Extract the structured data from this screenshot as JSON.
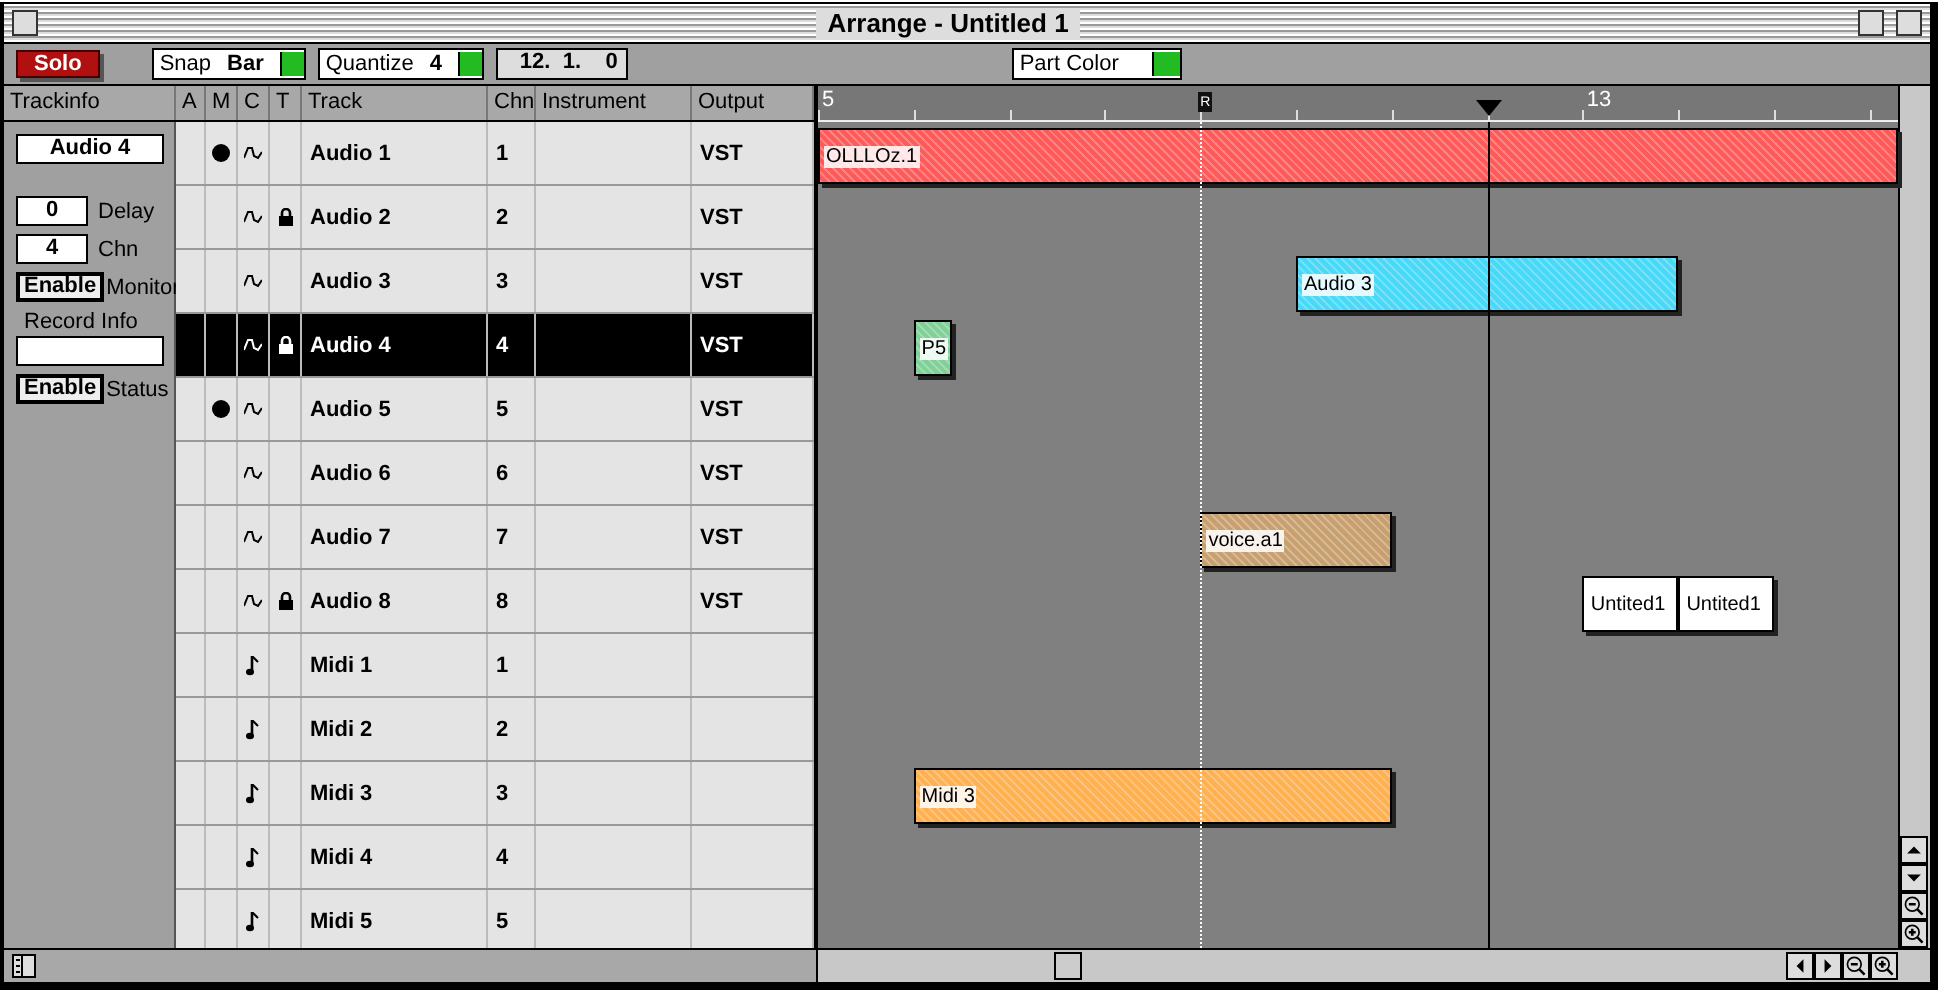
{
  "window": {
    "title": "Arrange - Untitled 1"
  },
  "toolbar": {
    "solo": "Solo",
    "snap": {
      "label": "Snap",
      "value": "Bar"
    },
    "quantize": {
      "label": "Quantize",
      "value": "4"
    },
    "position": "12.  1.    0",
    "part_color": "Part Color"
  },
  "columns": [
    "Trackinfo",
    "A",
    "M",
    "C",
    "T",
    "Track",
    "Chn",
    "Instrument",
    "Output"
  ],
  "trackinfo": {
    "name": "Audio 4",
    "delay": {
      "value": "0",
      "label": "Delay"
    },
    "chn": {
      "value": "4",
      "label": "Chn"
    },
    "monitor": {
      "button": "Enable",
      "label": "Monitor"
    },
    "record_info": {
      "label": "Record Info"
    },
    "status": {
      "button": "Enable",
      "label": "Status"
    }
  },
  "tracks": [
    {
      "name": "Audio 1",
      "kind": "audio",
      "record": true,
      "locked": false,
      "chn": "1",
      "output": "VST",
      "selected": false
    },
    {
      "name": "Audio 2",
      "kind": "audio",
      "record": false,
      "locked": true,
      "chn": "2",
      "output": "VST",
      "selected": false
    },
    {
      "name": "Audio 3",
      "kind": "audio",
      "record": false,
      "locked": false,
      "chn": "3",
      "output": "VST",
      "selected": false
    },
    {
      "name": "Audio 4",
      "kind": "audio",
      "record": false,
      "locked": true,
      "chn": "4",
      "output": "VST",
      "selected": true
    },
    {
      "name": "Audio 5",
      "kind": "audio",
      "record": true,
      "locked": false,
      "chn": "5",
      "output": "VST",
      "selected": false
    },
    {
      "name": "Audio 6",
      "kind": "audio",
      "record": false,
      "locked": false,
      "chn": "6",
      "output": "VST",
      "selected": false
    },
    {
      "name": "Audio 7",
      "kind": "audio",
      "record": false,
      "locked": false,
      "chn": "7",
      "output": "VST",
      "selected": false
    },
    {
      "name": "Audio 8",
      "kind": "audio",
      "record": false,
      "locked": true,
      "chn": "8",
      "output": "VST",
      "selected": false
    },
    {
      "name": "Midi 1",
      "kind": "midi",
      "record": false,
      "locked": false,
      "chn": "1",
      "selected": false
    },
    {
      "name": "Midi 2",
      "kind": "midi",
      "record": false,
      "locked": false,
      "chn": "2",
      "selected": false
    },
    {
      "name": "Midi 3",
      "kind": "midi",
      "record": false,
      "locked": false,
      "chn": "3",
      "selected": false
    },
    {
      "name": "Midi 4",
      "kind": "midi",
      "record": false,
      "locked": false,
      "chn": "4",
      "selected": false
    },
    {
      "name": "Midi 5",
      "kind": "midi",
      "record": false,
      "locked": false,
      "chn": "5",
      "selected": false
    }
  ],
  "ruler": {
    "labels": [
      "5",
      "13"
    ],
    "locator": "R"
  },
  "parts": [
    {
      "name": "OLLLOz.1",
      "color": "#ff5a5a"
    },
    {
      "name": "Audio 3",
      "color": "#48d8f8"
    },
    {
      "name": "P5",
      "color": "#80d098"
    },
    {
      "name": "voice.a1",
      "color": "#c8a070"
    },
    {
      "name": "Untited1",
      "color": "#ffffff"
    },
    {
      "name": "Untited1",
      "color": "#ffffff"
    },
    {
      "name": "Midi 3",
      "color": "#ffb050"
    }
  ]
}
